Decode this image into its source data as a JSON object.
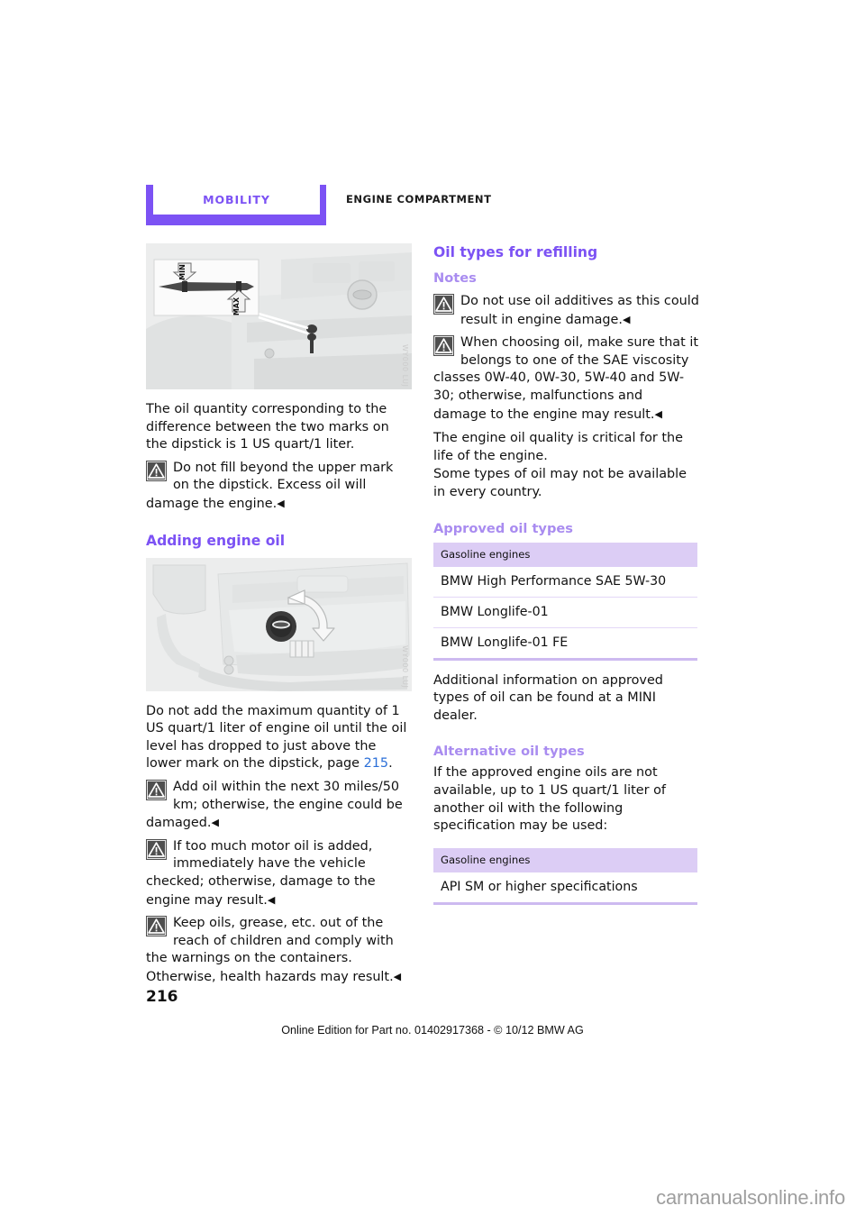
{
  "header": {
    "chapter": "MOBILITY",
    "section": "ENGINE COMPARTMENT"
  },
  "left_column": {
    "figure_dipstick": {
      "alt": "engine compartment dipstick with MIN and MAX marks",
      "watermark": "WY000 LUJ"
    },
    "p1": "The oil quantity corresponding to the difference between the two marks on the dipstick is 1 US quart/1 liter.",
    "warning1": "Do not fill beyond the upper mark on the dipstick. Excess oil will damage the engine.",
    "h2_adding": "Adding engine oil",
    "figure_filler": {
      "alt": "engine oil filler cap with turn arrow",
      "watermark": "WY000 LUJ"
    },
    "p2_a": "Do not add the maximum quantity of 1 US quart/1 liter of engine oil until the oil level has dropped to just above the lower mark on the dipstick, page ",
    "p2_link": "215",
    "p2_b": ".",
    "warning2": "Add oil within the next 30 miles/50 km; otherwise, the engine could be damaged.",
    "warning3": "If too much motor oil is added, immediately have the vehicle checked; otherwise, damage to the engine may result.",
    "warning4": "Keep oils, grease, etc. out of the reach of children and comply with the warnings on the containers. Otherwise, health hazards may result."
  },
  "right_column": {
    "h2_oil_types": "Oil types for refilling",
    "h3_notes": "Notes",
    "warning5": "Do not use oil additives as this could result in engine damage.",
    "warning6": "When choosing oil, make sure that it belongs to one of the SAE viscosity classes 0W-40, 0W-30, 5W-40 and 5W-30; otherwise, malfunctions and damage to the engine may result.",
    "p3": "The engine oil quality is critical for the life of the engine.",
    "p4": "Some types of oil may not be available in every country.",
    "h3_approved": "Approved oil types",
    "table_approved": {
      "header": "Gasoline engines",
      "rows": [
        "BMW High Performance SAE 5W-30",
        "BMW Longlife-01",
        "BMW Longlife-01 FE"
      ]
    },
    "p5": "Additional information on approved types of oil can be found at a MINI dealer.",
    "h3_alternative": "Alternative oil types",
    "p6": "If the approved engine oils are not available, up to 1 US quart/1 liter of another oil with the following specification may be used:",
    "table_alternative": {
      "header": "Gasoline engines",
      "rows": [
        "API SM or higher specifications"
      ]
    }
  },
  "footer": {
    "page_number": "216",
    "edition": "Online Edition for Part no. 01402917368 - © 10/12 BMW AG",
    "site_watermark": "carmanualsonline.info"
  },
  "marks": {
    "end_of_text": "◀"
  },
  "colors": {
    "accent": "#7C52F4",
    "accent_light": "#A98CF0",
    "table_header_bg": "#DCCDF5",
    "link": "#2B6FD8"
  }
}
